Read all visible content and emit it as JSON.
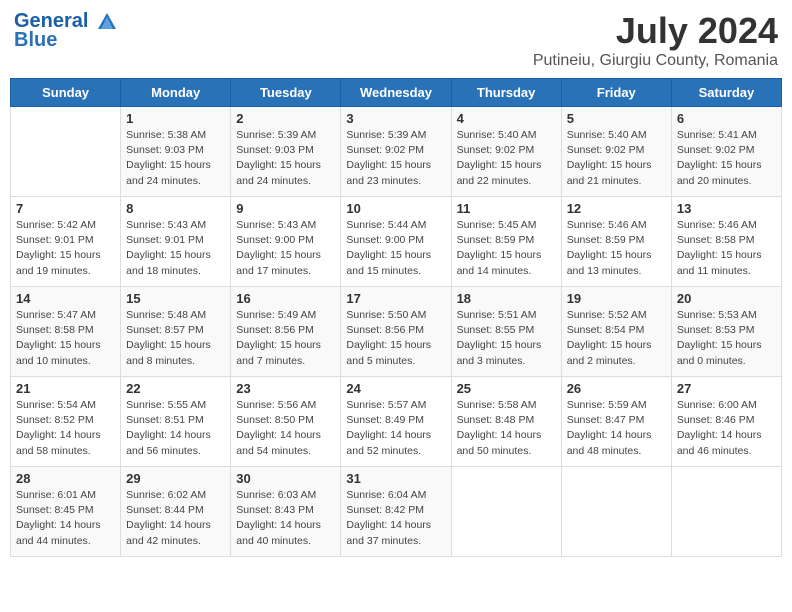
{
  "header": {
    "logo_line1": "General",
    "logo_line2": "Blue",
    "month": "July 2024",
    "location": "Putineiu, Giurgiu County, Romania"
  },
  "weekdays": [
    "Sunday",
    "Monday",
    "Tuesday",
    "Wednesday",
    "Thursday",
    "Friday",
    "Saturday"
  ],
  "weeks": [
    [
      {
        "day": "",
        "info": ""
      },
      {
        "day": "1",
        "info": "Sunrise: 5:38 AM\nSunset: 9:03 PM\nDaylight: 15 hours\nand 24 minutes."
      },
      {
        "day": "2",
        "info": "Sunrise: 5:39 AM\nSunset: 9:03 PM\nDaylight: 15 hours\nand 24 minutes."
      },
      {
        "day": "3",
        "info": "Sunrise: 5:39 AM\nSunset: 9:02 PM\nDaylight: 15 hours\nand 23 minutes."
      },
      {
        "day": "4",
        "info": "Sunrise: 5:40 AM\nSunset: 9:02 PM\nDaylight: 15 hours\nand 22 minutes."
      },
      {
        "day": "5",
        "info": "Sunrise: 5:40 AM\nSunset: 9:02 PM\nDaylight: 15 hours\nand 21 minutes."
      },
      {
        "day": "6",
        "info": "Sunrise: 5:41 AM\nSunset: 9:02 PM\nDaylight: 15 hours\nand 20 minutes."
      }
    ],
    [
      {
        "day": "7",
        "info": "Sunrise: 5:42 AM\nSunset: 9:01 PM\nDaylight: 15 hours\nand 19 minutes."
      },
      {
        "day": "8",
        "info": "Sunrise: 5:43 AM\nSunset: 9:01 PM\nDaylight: 15 hours\nand 18 minutes."
      },
      {
        "day": "9",
        "info": "Sunrise: 5:43 AM\nSunset: 9:00 PM\nDaylight: 15 hours\nand 17 minutes."
      },
      {
        "day": "10",
        "info": "Sunrise: 5:44 AM\nSunset: 9:00 PM\nDaylight: 15 hours\nand 15 minutes."
      },
      {
        "day": "11",
        "info": "Sunrise: 5:45 AM\nSunset: 8:59 PM\nDaylight: 15 hours\nand 14 minutes."
      },
      {
        "day": "12",
        "info": "Sunrise: 5:46 AM\nSunset: 8:59 PM\nDaylight: 15 hours\nand 13 minutes."
      },
      {
        "day": "13",
        "info": "Sunrise: 5:46 AM\nSunset: 8:58 PM\nDaylight: 15 hours\nand 11 minutes."
      }
    ],
    [
      {
        "day": "14",
        "info": "Sunrise: 5:47 AM\nSunset: 8:58 PM\nDaylight: 15 hours\nand 10 minutes."
      },
      {
        "day": "15",
        "info": "Sunrise: 5:48 AM\nSunset: 8:57 PM\nDaylight: 15 hours\nand 8 minutes."
      },
      {
        "day": "16",
        "info": "Sunrise: 5:49 AM\nSunset: 8:56 PM\nDaylight: 15 hours\nand 7 minutes."
      },
      {
        "day": "17",
        "info": "Sunrise: 5:50 AM\nSunset: 8:56 PM\nDaylight: 15 hours\nand 5 minutes."
      },
      {
        "day": "18",
        "info": "Sunrise: 5:51 AM\nSunset: 8:55 PM\nDaylight: 15 hours\nand 3 minutes."
      },
      {
        "day": "19",
        "info": "Sunrise: 5:52 AM\nSunset: 8:54 PM\nDaylight: 15 hours\nand 2 minutes."
      },
      {
        "day": "20",
        "info": "Sunrise: 5:53 AM\nSunset: 8:53 PM\nDaylight: 15 hours\nand 0 minutes."
      }
    ],
    [
      {
        "day": "21",
        "info": "Sunrise: 5:54 AM\nSunset: 8:52 PM\nDaylight: 14 hours\nand 58 minutes."
      },
      {
        "day": "22",
        "info": "Sunrise: 5:55 AM\nSunset: 8:51 PM\nDaylight: 14 hours\nand 56 minutes."
      },
      {
        "day": "23",
        "info": "Sunrise: 5:56 AM\nSunset: 8:50 PM\nDaylight: 14 hours\nand 54 minutes."
      },
      {
        "day": "24",
        "info": "Sunrise: 5:57 AM\nSunset: 8:49 PM\nDaylight: 14 hours\nand 52 minutes."
      },
      {
        "day": "25",
        "info": "Sunrise: 5:58 AM\nSunset: 8:48 PM\nDaylight: 14 hours\nand 50 minutes."
      },
      {
        "day": "26",
        "info": "Sunrise: 5:59 AM\nSunset: 8:47 PM\nDaylight: 14 hours\nand 48 minutes."
      },
      {
        "day": "27",
        "info": "Sunrise: 6:00 AM\nSunset: 8:46 PM\nDaylight: 14 hours\nand 46 minutes."
      }
    ],
    [
      {
        "day": "28",
        "info": "Sunrise: 6:01 AM\nSunset: 8:45 PM\nDaylight: 14 hours\nand 44 minutes."
      },
      {
        "day": "29",
        "info": "Sunrise: 6:02 AM\nSunset: 8:44 PM\nDaylight: 14 hours\nand 42 minutes."
      },
      {
        "day": "30",
        "info": "Sunrise: 6:03 AM\nSunset: 8:43 PM\nDaylight: 14 hours\nand 40 minutes."
      },
      {
        "day": "31",
        "info": "Sunrise: 6:04 AM\nSunset: 8:42 PM\nDaylight: 14 hours\nand 37 minutes."
      },
      {
        "day": "",
        "info": ""
      },
      {
        "day": "",
        "info": ""
      },
      {
        "day": "",
        "info": ""
      }
    ]
  ]
}
